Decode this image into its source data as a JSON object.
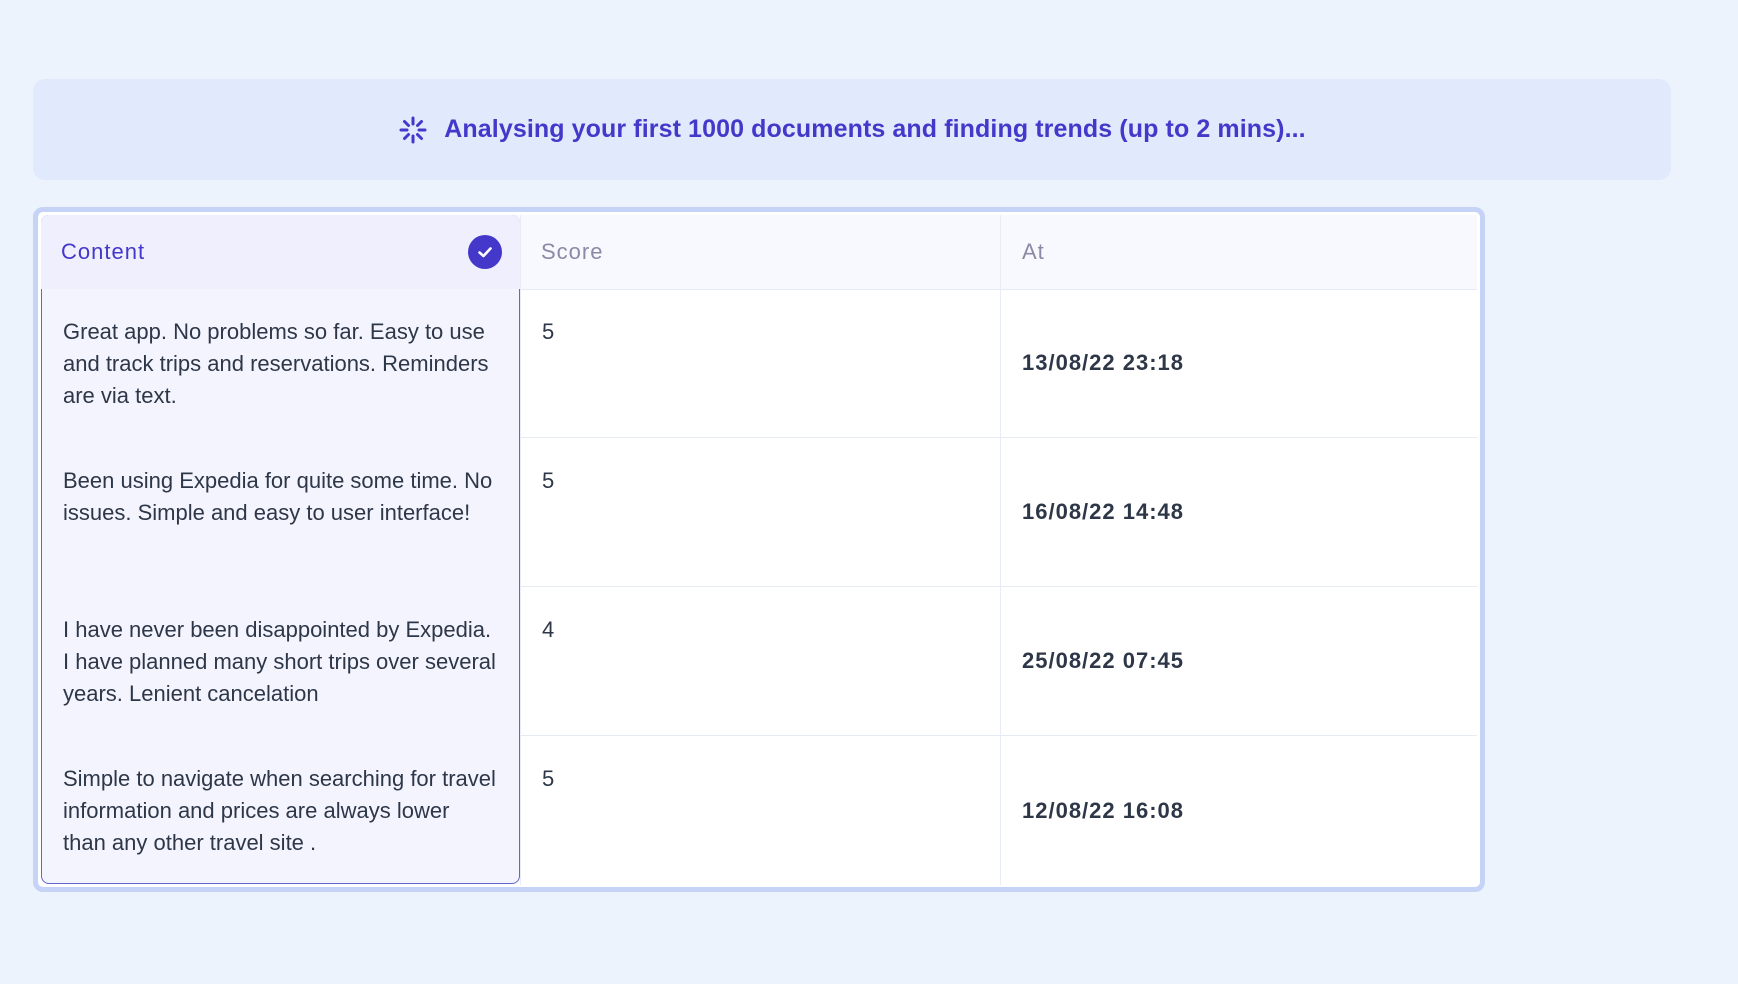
{
  "banner": {
    "text": "Analysing your first 1000 documents and finding trends (up to 2 mins)..."
  },
  "table": {
    "columns": [
      {
        "label": "Content",
        "selected": true
      },
      {
        "label": "Score"
      },
      {
        "label": "At"
      }
    ],
    "rows": [
      {
        "content": "Great app. No problems so far. Easy to use and track trips and reservations. Reminders are via text.",
        "score": "5",
        "at": "13/08/22 23:18"
      },
      {
        "content": "Been using Expedia for quite some time. No issues. Simple and easy to user interface!",
        "score": "5",
        "at": "16/08/22 14:48"
      },
      {
        "content": "I have never been disappointed by Expedia. I have planned many short trips over several years. Lenient cancelation",
        "score": "4",
        "at": "25/08/22 07:45"
      },
      {
        "content": "Simple to navigate when searching for travel information and prices are always lower than any other travel site .",
        "score": "5",
        "at": "12/08/22 16:08"
      }
    ]
  },
  "colors": {
    "accent": "#4338ca",
    "background": "#edf3fd",
    "banner_bg": "#e1e9fc",
    "frame_border": "#c4d3f6"
  }
}
